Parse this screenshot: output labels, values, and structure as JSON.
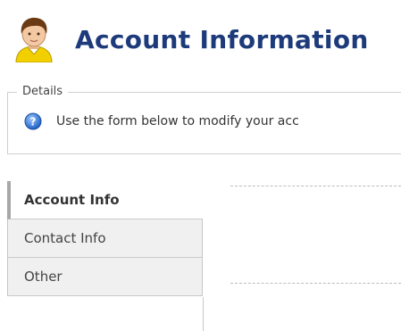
{
  "header": {
    "title": "Account Information",
    "icon": "user-avatar-icon"
  },
  "details": {
    "legend": "Details",
    "icon": "help-icon",
    "text": "Use the form below to modify your acc"
  },
  "tabs": [
    {
      "label": "Account Info",
      "active": true
    },
    {
      "label": "Contact Info",
      "active": false
    },
    {
      "label": "Other",
      "active": false
    }
  ],
  "colors": {
    "title": "#1d3a7a",
    "tab_bg": "#f0f0f0",
    "border": "#c8c8c8"
  }
}
